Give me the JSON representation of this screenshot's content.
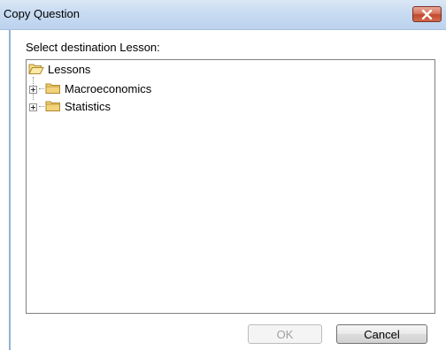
{
  "window": {
    "title": "Copy Question",
    "close_icon": "close-x-icon"
  },
  "dialog": {
    "prompt": "Select destination Lesson:"
  },
  "tree": {
    "root": {
      "label": "Lessons",
      "icon": "open-folder-icon"
    },
    "children": [
      {
        "label": "Macroeconomics",
        "icon": "folder-icon",
        "expander": "plus-expander-icon"
      },
      {
        "label": "Statistics",
        "icon": "folder-icon",
        "expander": "plus-expander-icon"
      }
    ]
  },
  "buttons": {
    "ok_label": "OK",
    "ok_enabled": false,
    "cancel_label": "Cancel"
  },
  "colors": {
    "titlebar": "#c9dcf2",
    "close_button": "#c04a2c",
    "folder": "#f2d27a"
  }
}
